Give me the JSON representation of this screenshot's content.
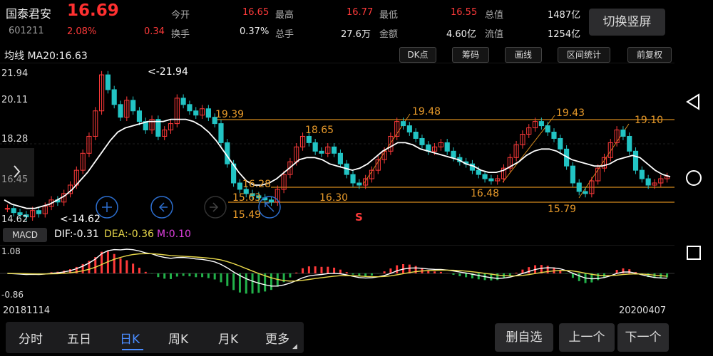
{
  "stock": {
    "name": "国泰君安",
    "code": "601211",
    "price": "16.69",
    "change_pct": "2.08%",
    "change": "0.34"
  },
  "quote": {
    "open_label": "今开",
    "open": "16.65",
    "high_label": "最高",
    "high": "16.77",
    "low_label": "最低",
    "low": "16.55",
    "mcap_label": "总值",
    "mcap": "1487亿",
    "turnover_label": "换手",
    "turnover": "0.37%",
    "volume_label": "总手",
    "volume": "27.6万",
    "amount_label": "金额",
    "amount": "4.60亿",
    "float_label": "流值",
    "float": "1254亿"
  },
  "switch_label": "切换竖屏",
  "indicator": {
    "label": "均线",
    "ma": "MA20:16.63"
  },
  "toolbar": {
    "dk": "DK点",
    "chips": "筹码",
    "draw": "画线",
    "range": "区间统计",
    "adjust": "前复权"
  },
  "price_axis": {
    "top": "21.94",
    "t2": "20.11",
    "t3": "18.28",
    "t4": "16.45",
    "bottom": "14.62"
  },
  "annotations": {
    "high": "<-21.94",
    "low": "<-14.62",
    "a1": "19.39",
    "a2": "18.65",
    "a3": "16.28",
    "a4": "15.63",
    "a5": "15.49",
    "a6": "16.30",
    "a7": "19.48",
    "a8": "16.48",
    "a9": "19.43",
    "a10": "15.79",
    "a11": "19.10",
    "signal": "S"
  },
  "macd": {
    "button": "MACD",
    "dif": "DIF:-0.31",
    "dea": "DEA:-0.36",
    "m": "M:0.10",
    "axis_top": "1.08",
    "axis_bottom": "-0.86"
  },
  "dates": {
    "start": "20181114",
    "end": "20200407"
  },
  "tabs": [
    "分时",
    "五日",
    "日K",
    "周K",
    "月K",
    "更多"
  ],
  "actions": {
    "remove": "删自选",
    "prev": "上一个",
    "next": "下一个"
  },
  "colors": {
    "up": "#ff3a3a",
    "down": "#22c4c4",
    "ma": "#ffffff",
    "level": "#d48a1c",
    "dea": "#e8d84a",
    "active_tab": "#4a8cff"
  },
  "chart_data": {
    "type": "candlestick",
    "ylim": [
      14.62,
      21.94
    ],
    "ma_label": "MA20",
    "close": [
      15.2,
      15.0,
      14.9,
      14.8,
      15.1,
      14.95,
      15.3,
      15.6,
      15.5,
      15.9,
      16.3,
      17.0,
      17.8,
      18.6,
      19.8,
      21.5,
      20.8,
      20.1,
      19.5,
      20.3,
      19.8,
      19.3,
      18.9,
      19.4,
      18.6,
      18.9,
      19.2,
      20.4,
      20.1,
      19.8,
      19.6,
      19.9,
      19.5,
      19.2,
      18.3,
      17.3,
      16.4,
      16.1,
      15.9,
      15.8,
      15.7,
      15.6,
      15.5,
      16.1,
      16.8,
      17.4,
      18.1,
      18.6,
      18.3,
      17.9,
      17.8,
      18.1,
      17.8,
      17.3,
      16.8,
      16.4,
      16.3,
      16.6,
      17.0,
      17.5,
      17.9,
      18.6,
      19.3,
      19.1,
      18.8,
      18.5,
      18.2,
      17.9,
      18.1,
      18.3,
      17.9,
      17.6,
      17.4,
      17.3,
      17.0,
      16.8,
      16.6,
      16.5,
      16.6,
      17.1,
      17.6,
      18.2,
      18.7,
      19.0,
      19.3,
      19.1,
      18.8,
      18.5,
      18.0,
      17.2,
      16.4,
      16.0,
      15.9,
      16.5,
      17.1,
      17.6,
      18.3,
      18.9,
      18.6,
      17.9,
      17.0,
      16.6,
      16.3,
      16.4,
      16.6,
      16.7
    ],
    "ma20": [
      15.6,
      15.4,
      15.3,
      15.2,
      15.2,
      15.3,
      15.4,
      15.6,
      15.8,
      16.1,
      16.5,
      16.9,
      17.4,
      17.9,
      18.4,
      18.8,
      19.0,
      19.1,
      19.2,
      19.3,
      19.3,
      19.3,
      19.4,
      19.4,
      19.4,
      19.3,
      19.1,
      18.8,
      18.4,
      17.9,
      17.4,
      16.9,
      16.5,
      16.3,
      16.3,
      16.4,
      16.6,
      16.9,
      17.2,
      17.5,
      17.6,
      17.6,
      17.5,
      17.3,
      17.2,
      17.1,
      17.0,
      17.1,
      17.3,
      17.6,
      17.9,
      18.1,
      18.3,
      18.3,
      18.2,
      18.0,
      17.9,
      17.8,
      17.7,
      17.6,
      17.5,
      17.3,
      17.2,
      17.0,
      16.9,
      16.9,
      17.0,
      17.2,
      17.4,
      17.7,
      17.9,
      18.0,
      18.0,
      17.9,
      17.7,
      17.5,
      17.4,
      17.3,
      17.2,
      17.2,
      17.3,
      17.5,
      17.6,
      17.7,
      17.6,
      17.3,
      17.0,
      16.8,
      16.7
    ],
    "dates": [
      "20181114",
      "20200407"
    ]
  }
}
